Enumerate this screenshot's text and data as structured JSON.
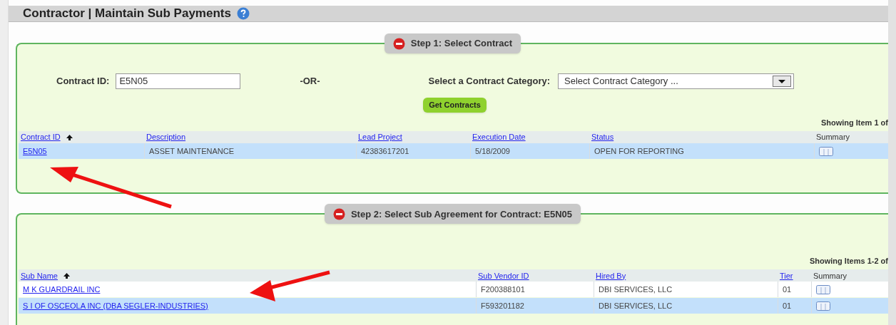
{
  "page_title": "Contractor | Maintain Sub Payments",
  "step1": {
    "legend": "Step 1: Select Contract",
    "contract_id_label": "Contract ID:",
    "contract_id_value": "E5N05",
    "or_text": "-OR-",
    "category_label": "Select a Contract Category:",
    "category_value": "Select Contract Category ...",
    "button": "Get Contracts",
    "showing": "Showing Item 1 of",
    "columns": [
      {
        "label": "Contract ID",
        "kind": "link",
        "sorted": true
      },
      {
        "label": "Description",
        "kind": "link",
        "sorted": false
      },
      {
        "label": "Lead Project",
        "kind": "link",
        "sorted": false
      },
      {
        "label": "Execution Date",
        "kind": "link",
        "sorted": false
      },
      {
        "label": "Status",
        "kind": "link",
        "sorted": false
      },
      {
        "label": "Summary",
        "kind": "text",
        "sorted": false
      }
    ],
    "rows": [
      {
        "selected": true,
        "cells": [
          "E5N05",
          "ASSET MAINTENANCE",
          "42383617201",
          "5/18/2009",
          "OPEN FOR REPORTING"
        ]
      }
    ]
  },
  "step2": {
    "legend": "Step 2: Select Sub Agreement for Contract: E5N05",
    "showing": "Showing Items 1-2 of",
    "columns": [
      {
        "label": "Sub Name",
        "kind": "link",
        "sorted": true
      },
      {
        "label": "Sub Vendor ID",
        "kind": "link",
        "sorted": false
      },
      {
        "label": "Hired By",
        "kind": "link",
        "sorted": false
      },
      {
        "label": "Tier",
        "kind": "link",
        "sorted": false
      },
      {
        "label": "Summary",
        "kind": "text",
        "sorted": false
      }
    ],
    "rows": [
      {
        "selected": false,
        "cells": [
          "M K GUARDRAIL INC",
          "F200388101",
          "DBI SERVICES, LLC",
          "01"
        ]
      },
      {
        "selected": true,
        "cells": [
          "S I OF OSCEOLA INC (DBA SEGLER-INDUSTRIES)",
          "F593201182",
          "DBI SERVICES, LLC",
          "01"
        ]
      }
    ]
  }
}
